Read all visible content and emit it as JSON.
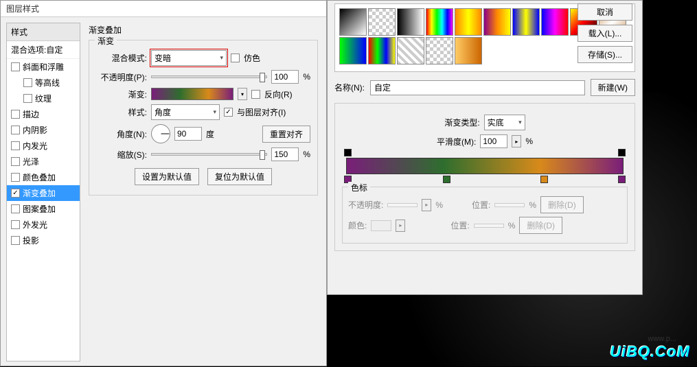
{
  "main_dialog": {
    "title": "图层样式",
    "styles_header": "样式",
    "blend_options": "混合选项:自定",
    "items": [
      {
        "label": "斜面和浮雕",
        "checked": false,
        "indent": false
      },
      {
        "label": "等高线",
        "checked": false,
        "indent": true
      },
      {
        "label": "纹理",
        "checked": false,
        "indent": true
      },
      {
        "label": "描边",
        "checked": false,
        "indent": false
      },
      {
        "label": "内阴影",
        "checked": false,
        "indent": false
      },
      {
        "label": "内发光",
        "checked": false,
        "indent": false
      },
      {
        "label": "光泽",
        "checked": false,
        "indent": false
      },
      {
        "label": "颜色叠加",
        "checked": false,
        "indent": false
      },
      {
        "label": "渐变叠加",
        "checked": true,
        "indent": false,
        "selected": true
      },
      {
        "label": "图案叠加",
        "checked": false,
        "indent": false
      },
      {
        "label": "外发光",
        "checked": false,
        "indent": false
      },
      {
        "label": "投影",
        "checked": false,
        "indent": false
      }
    ]
  },
  "panel": {
    "section_title": "渐变叠加",
    "group_title": "渐变",
    "blend_mode_label": "混合模式:",
    "blend_mode_value": "变暗",
    "dither_label": "仿色",
    "opacity_label": "不透明度(P):",
    "opacity_value": "100",
    "percent": "%",
    "gradient_label": "渐变:",
    "reverse_label": "反向(R)",
    "style_label": "样式:",
    "style_value": "角度",
    "align_label": "与图层对齐(I)",
    "angle_label": "角度(N):",
    "angle_value": "90",
    "degree": "度",
    "reset_align": "重置对齐",
    "scale_label": "缩放(S):",
    "scale_value": "150",
    "set_default": "设置为默认值",
    "reset_default": "复位为默认值"
  },
  "editor": {
    "cancel": "取消",
    "load": "载入(L)...",
    "save": "存储(S)...",
    "name_label": "名称(N):",
    "name_value": "自定",
    "new_btn": "新建(W)",
    "grad_type_label": "渐变类型:",
    "grad_type_value": "实底",
    "smoothness_label": "平滑度(M):",
    "smoothness_value": "100",
    "percent": "%",
    "stops_title": "色标",
    "stop_opacity_label": "不透明度:",
    "stop_position_label": "位置:",
    "stop_color_label": "颜色:",
    "delete_btn": "删除(D)"
  },
  "watermark": "UiBQ.CoM",
  "watermark2": "www.p..."
}
